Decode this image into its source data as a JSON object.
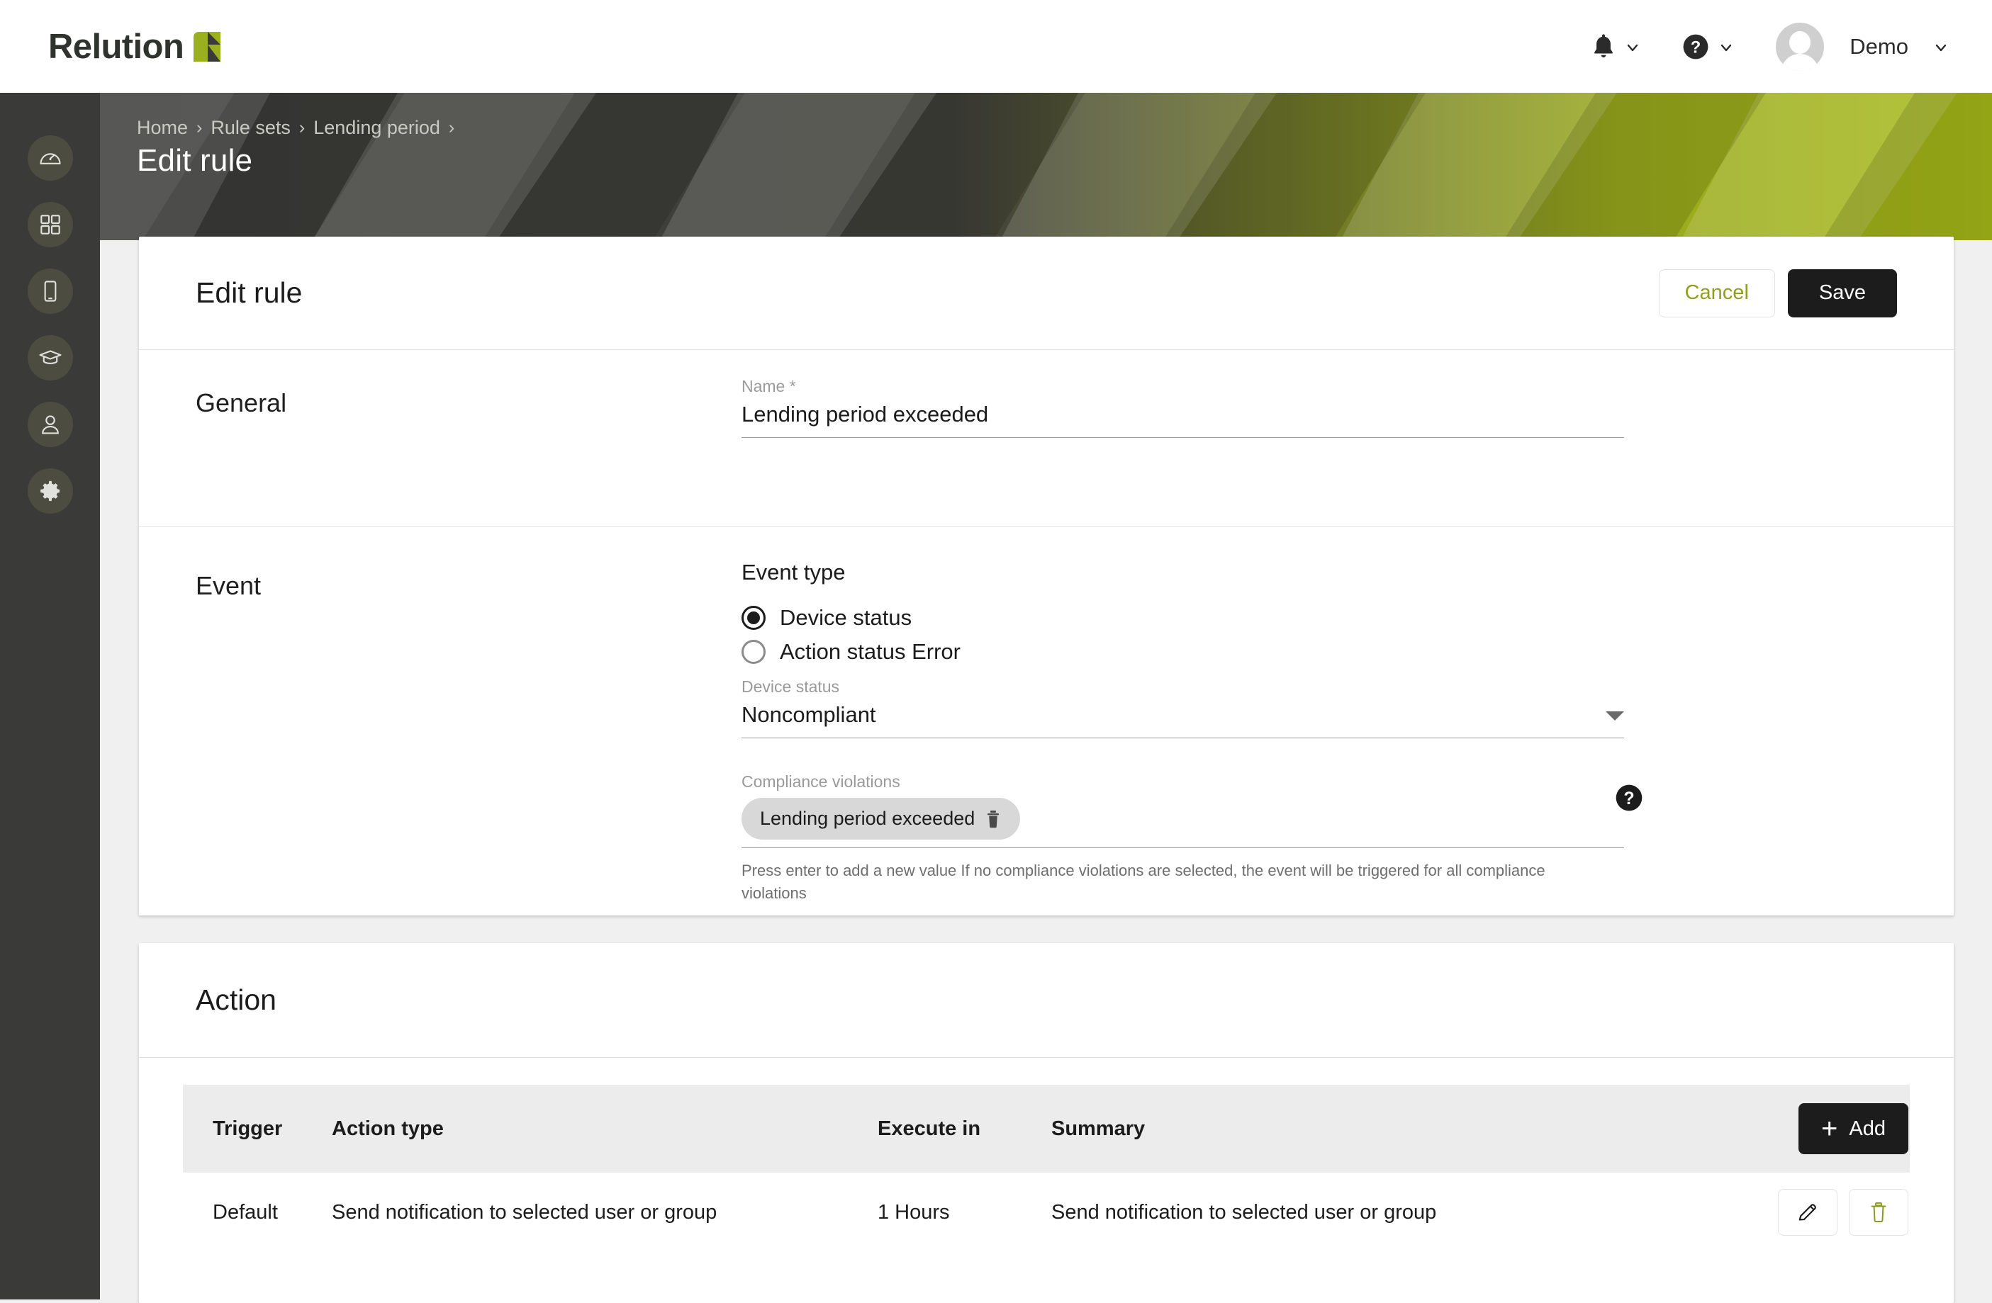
{
  "brand": {
    "name": "Relution",
    "logo_icon": "relution-logo-icon",
    "accent": "#9ab01e"
  },
  "topbar": {
    "notifications_icon": "bell-icon",
    "help_icon": "help-circle-icon",
    "chevron_icon": "chevron-down-icon",
    "avatar_icon": "avatar-icon",
    "user_name": "Demo"
  },
  "sidebar": {
    "items": [
      {
        "icon": "dashboard-gauge-icon",
        "name": "dashboard"
      },
      {
        "icon": "apps-grid-icon",
        "name": "apps"
      },
      {
        "icon": "mobile-device-icon",
        "name": "devices"
      },
      {
        "icon": "graduation-cap-icon",
        "name": "education"
      },
      {
        "icon": "user-icon",
        "name": "users"
      },
      {
        "icon": "gear-icon",
        "name": "settings"
      }
    ]
  },
  "banner": {
    "breadcrumb": [
      "Home",
      "Rule sets",
      "Lending period"
    ],
    "separator": "›",
    "trailing_separator": "›",
    "page_title": "Edit rule"
  },
  "rule_card": {
    "title": "Edit rule",
    "cancel_label": "Cancel",
    "save_label": "Save",
    "general": {
      "section_label": "General",
      "name_label": "Name *",
      "name_value": "Lending period exceeded"
    },
    "event": {
      "section_label": "Event",
      "event_type_label": "Event type",
      "options": [
        {
          "label": "Device status",
          "selected": true
        },
        {
          "label": "Action status Error",
          "selected": false
        }
      ],
      "device_status_label": "Device status",
      "device_status_value": "Noncompliant",
      "caret_icon": "caret-down-icon",
      "compliance_label": "Compliance violations",
      "compliance_chips": [
        {
          "label": "Lending period exceeded",
          "delete_icon": "trash-icon"
        }
      ],
      "help_icon": "help-circle-icon",
      "hint": "Press enter to add a new value If no compliance violations are selected, the event will be triggered for all compliance violations"
    }
  },
  "action_card": {
    "title": "Action",
    "add_label": "Add",
    "add_icon": "plus-icon",
    "columns": [
      "Trigger",
      "Action type",
      "Execute in",
      "Summary"
    ],
    "rows": [
      {
        "trigger": "Default",
        "action_type": "Send notification to selected user or group",
        "execute_in": "1 Hours",
        "summary": "Send notification to selected user or group",
        "edit_icon": "pencil-icon",
        "delete_icon": "trash-icon"
      }
    ]
  },
  "colors": {
    "accent_green": "#8fa01e",
    "dark": "#1c1c1c",
    "sidebar_bg": "#3a3a38",
    "page_bg": "#f0f0f0"
  }
}
